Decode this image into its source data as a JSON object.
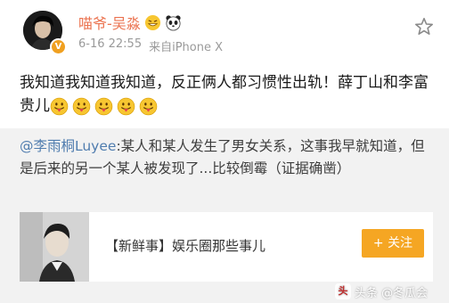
{
  "header": {
    "username": "喵爷-吴淼",
    "timestamp": "6-16 22:55",
    "source": "来自iPhone X",
    "verified_badge": "V"
  },
  "post": {
    "text": "我知道我知道我知道，反正俩人都习惯性出轨！薛丁山和李富贵儿",
    "emoji_count": 5
  },
  "repost": {
    "mention": "@李雨桐Luyee",
    "text": ":某人和某人发生了男女关系，这事我早就知道，但是后来的另一个某人被发现了...比较倒霉（证据确凿）",
    "card": {
      "title": "【新鲜事】娱乐圈那些事儿",
      "follow_label": "+ 关注"
    }
  },
  "watermark": {
    "label": "头条 @冬瓜会"
  },
  "colors": {
    "username": "#eb7350",
    "mention": "#507daf",
    "follow_button": "#f5a623",
    "repost_bg": "#f2f2f2"
  },
  "icons": [
    "avatar",
    "verified-badge",
    "grin-emoji",
    "panda-emoji",
    "star-icon",
    "tongue-emoji",
    "watermark-logo"
  ]
}
